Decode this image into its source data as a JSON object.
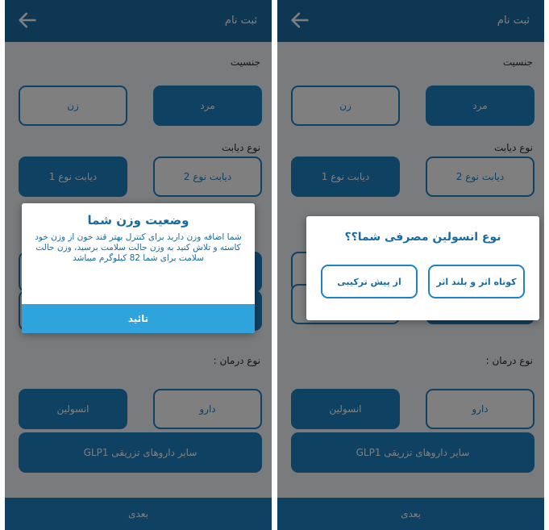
{
  "colors": {
    "primary": "#1f82c6",
    "appbar": "#1d6fa8",
    "confirm": "#2fa3dc",
    "dialog_text": "#1a6a9e"
  },
  "icons": {
    "back": "arrow-left-icon"
  },
  "screens": [
    {
      "app_title": "ثبت نام",
      "gender_label": "جنسیت",
      "gender_options": [
        "مرد",
        "زن"
      ],
      "diabetes_label": "نوع دیابت",
      "diabetes_options": [
        "دیابت نوع 2",
        "دیابت نوع 1"
      ],
      "treatment_label": "نوع درمان :",
      "treatment_options": [
        "دارو",
        "انسولین"
      ],
      "treatment_other": "سایر داروهای تزریقی GLP1",
      "next_label": "بعدی",
      "dialog": {
        "title": "وضعیت وزن شما",
        "message": "شما اضافه وزن دارید برای کنترل بهتر قند خون از وزن خود کاسته و تلاش کنید به وزن حالت سلامت برسید، وزن حالت سلامت برای شما 82 کیلوگرم میباشد",
        "confirm_label": "تائید"
      }
    },
    {
      "app_title": "ثبت نام",
      "gender_label": "جنسیت",
      "gender_options": [
        "مرد",
        "زن"
      ],
      "diabetes_label": "نوع دیابت",
      "diabetes_options": [
        "دیابت نوع 2",
        "دیابت نوع 1"
      ],
      "treatment_label": "نوع درمان :",
      "treatment_options": [
        "دارو",
        "انسولین"
      ],
      "treatment_other": "سایر داروهای تزریقی GLP1",
      "next_label": "بعدی",
      "dialog": {
        "title": "نوع انسولین مصرفی شما؟؟",
        "options": [
          "کوتاه اثر و بلند اثر",
          "از پیش ترکیبی"
        ]
      }
    }
  ]
}
